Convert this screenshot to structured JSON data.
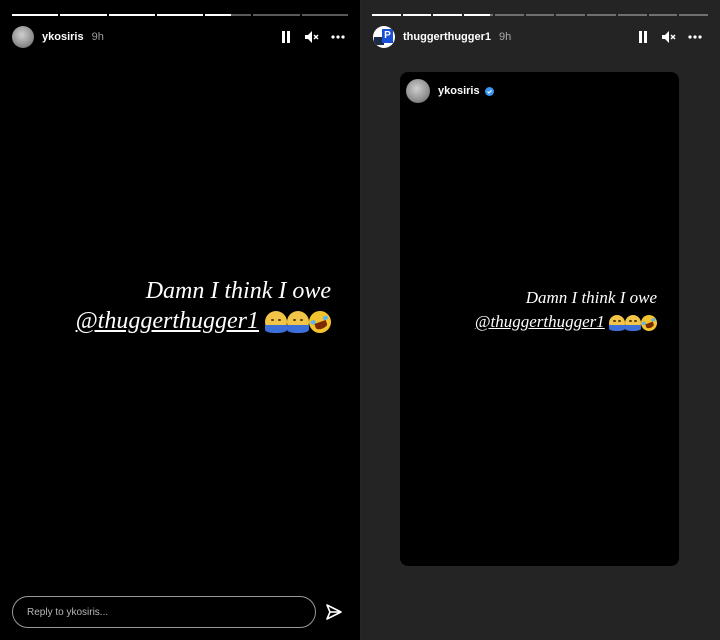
{
  "colors": {
    "left_bg": "#000000",
    "right_bg": "#242424",
    "text": "#ffffff",
    "verified": "#3897f0"
  },
  "left_story": {
    "progress": [
      1,
      1,
      1,
      1,
      0.55,
      0,
      0
    ],
    "header": {
      "username": "ykosiris",
      "time": "9h"
    },
    "controls": {
      "pause_icon": "pause-icon",
      "mute_icon": "volume-mute-icon",
      "more_icon": "more-icon"
    },
    "caption": {
      "line1": "Damn I think I owe",
      "mention": "@thuggerthugger1",
      "emoji": [
        "shushing-face",
        "shushing-face",
        "rolling-on-floor-laughing"
      ]
    },
    "reply": {
      "placeholder": "Reply to ykosiris..."
    },
    "send_icon": "send-icon"
  },
  "right_story": {
    "progress": [
      1,
      1,
      1,
      0.9,
      0,
      0,
      0,
      0,
      0,
      0,
      0
    ],
    "header": {
      "username": "thuggerthugger1",
      "time": "9h"
    },
    "controls": {
      "pause_icon": "pause-icon",
      "mute_icon": "volume-mute-icon",
      "more_icon": "more-icon"
    },
    "shared_post": {
      "username": "ykosiris",
      "verified": true,
      "caption": {
        "line1": "Damn I think I owe",
        "mention": "@thuggerthugger1",
        "emoji": [
          "shushing-face",
          "shushing-face",
          "rolling-on-floor-laughing"
        ]
      }
    }
  }
}
